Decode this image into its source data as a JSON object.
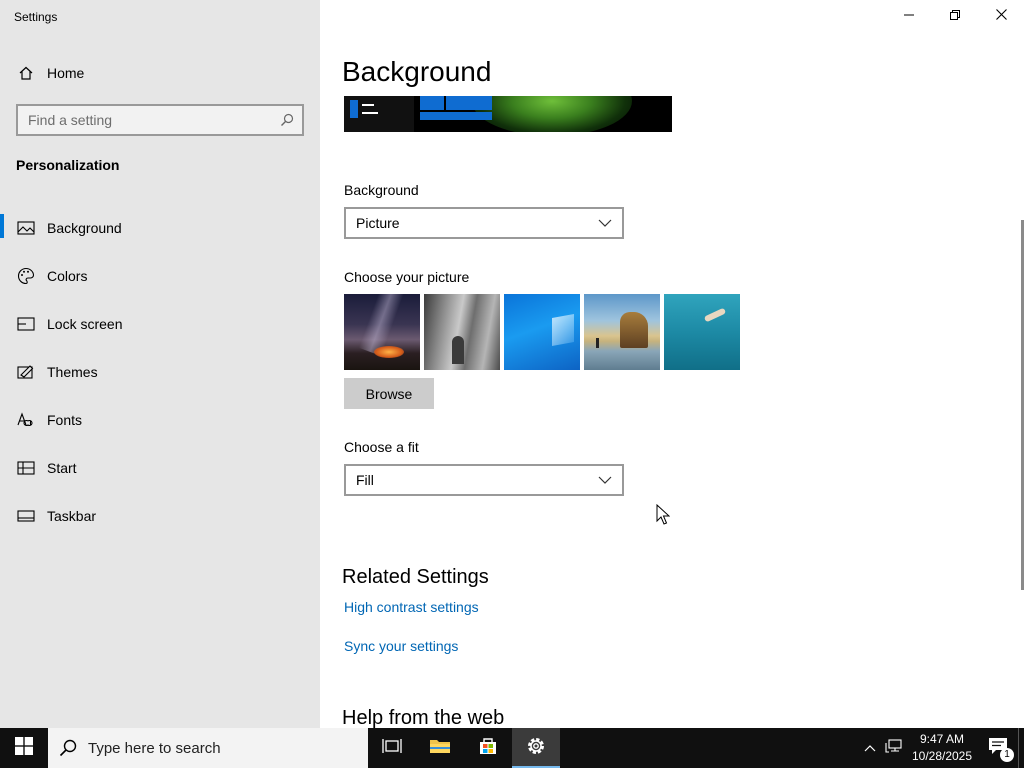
{
  "window": {
    "app_title": "Settings",
    "caption_buttons": [
      "minimize-icon",
      "restore-icon",
      "close-icon"
    ]
  },
  "sidebar": {
    "home_label": "Home",
    "search_placeholder": "Find a setting",
    "section_title": "Personalization",
    "items": [
      {
        "label": "Background",
        "icon": "picture-icon",
        "active": true
      },
      {
        "label": "Colors",
        "icon": "palette-icon",
        "active": false
      },
      {
        "label": "Lock screen",
        "icon": "lock-screen-icon",
        "active": false
      },
      {
        "label": "Themes",
        "icon": "themes-icon",
        "active": false
      },
      {
        "label": "Fonts",
        "icon": "fonts-icon",
        "active": false
      },
      {
        "label": "Start",
        "icon": "start-icon",
        "active": false
      },
      {
        "label": "Taskbar",
        "icon": "taskbar-icon",
        "active": false
      }
    ]
  },
  "main": {
    "page_title": "Background",
    "background_label": "Background",
    "background_value": "Picture",
    "choose_picture_label": "Choose your picture",
    "pictures": [
      "night-sky-tent",
      "rock-cliff",
      "windows-blue",
      "beach-rock",
      "underwater-swimmer"
    ],
    "browse_label": "Browse",
    "fit_label": "Choose a fit",
    "fit_value": "Fill",
    "related_title": "Related Settings",
    "related_links": [
      "High contrast settings",
      "Sync your settings"
    ],
    "help_title": "Help from the web"
  },
  "taskbar": {
    "search_placeholder": "Type here to search",
    "time": "9:47 AM",
    "date": "10/28/2025",
    "notification_count": "1",
    "accent": "#76b9ed"
  },
  "colors": {
    "accent": "#0078d7",
    "link": "#0066b4",
    "sidebar_bg": "#e6e6e6"
  }
}
